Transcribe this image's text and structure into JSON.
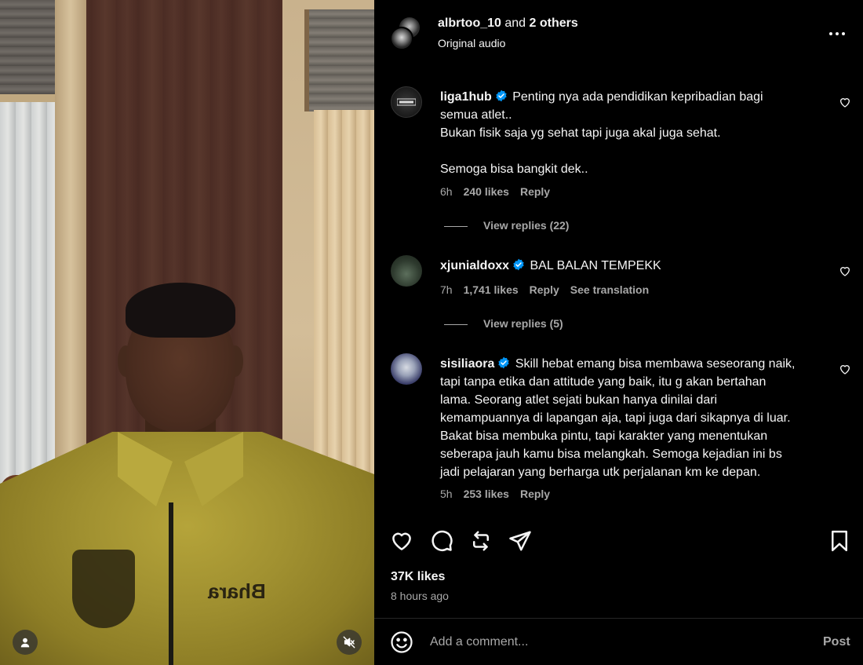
{
  "post_header": {
    "author": "albrtoo_10",
    "coauthors_text": "and",
    "others": "2 others",
    "audio": "Original audio"
  },
  "comments": [
    {
      "username": "liga1hub",
      "verified": true,
      "text_lines": [
        "Penting nya ada pendidikan kepribadian bagi",
        "semua atlet..",
        "Bukan fisik saja yg sehat tapi juga akal juga sehat.",
        "",
        "Semoga bisa bangkit dek.."
      ],
      "time": "6h",
      "likes": "240 likes",
      "reply": "Reply",
      "view_replies": "View replies (22)"
    },
    {
      "username": "xjunialdoxx",
      "verified": true,
      "text_lines": [
        "BAL BALAN TEMPEKK"
      ],
      "time": "7h",
      "likes": "1,741 likes",
      "reply": "Reply",
      "translate": "See translation",
      "view_replies": "View replies (5)"
    },
    {
      "username": "sisiliaora",
      "verified": true,
      "text_lines": [
        "Skill hebat emang bisa membawa seseorang naik,",
        "tapi tanpa etika dan attitude yang baik, itu g akan bertahan",
        "lama. Seorang atlet sejati bukan hanya dinilai dari",
        "kemampuannya di lapangan aja, tapi juga dari sikapnya di luar.",
        "Bakat bisa membuka pintu, tapi karakter yang menentukan",
        "seberapa jauh kamu bisa melangkah. Semoga kejadian ini bs",
        "jadi pelajaran yang berharga utk perjalanan km ke depan."
      ],
      "time": "5h",
      "likes": "253 likes",
      "reply": "Reply"
    }
  ],
  "video": {
    "jersey_text": "Bhara"
  },
  "actions": {
    "icons": [
      "heart-icon",
      "comment-icon",
      "repost-icon",
      "share-icon",
      "bookmark-icon"
    ]
  },
  "post_stats": {
    "likes": "37K likes",
    "time_ago": "8 hours ago"
  },
  "add_comment": {
    "placeholder": "Add a comment...",
    "post_label": "Post"
  },
  "colors": {
    "background": "#000000",
    "text": "#f5f5f5",
    "secondary_text": "#a8a8a8",
    "verified": "#0095f6"
  }
}
